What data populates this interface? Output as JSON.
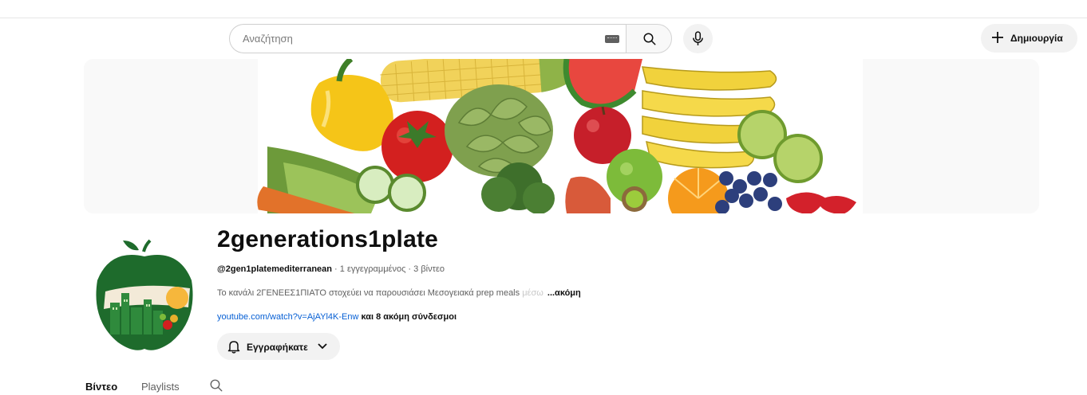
{
  "header": {
    "search": {
      "placeholder": "Αναζήτηση"
    },
    "create_label": "Δημιουργία"
  },
  "channel": {
    "name": "2generations1plate",
    "handle": "@2gen1platemediterranean",
    "meta": " · 1 εγγεγραμμένος · 3 βίντεο",
    "description": "Το κανάλι 2ΓΕΝΕΕΣ1ΠΙΑΤΟ στοχεύει να παρουσιάσει Μεσογειακά prep meals",
    "description_fade": "μέσω",
    "more_label": "...ακόμη",
    "link_url": "youtube.com/watch?v=AjAYl4K-Enw",
    "link_more": " και 8 ακόμη σύνδεσμοι",
    "subscribe_label": "Εγγραφήκατε"
  },
  "tabs": [
    "Βίντεο",
    "Playlists"
  ],
  "icons": [
    "keyboard-icon",
    "search-icon",
    "mic-icon",
    "plus-icon",
    "bell-icon",
    "chevron-down-icon",
    "tab-search-icon"
  ],
  "colors": {
    "link": "#065fd4",
    "apple_green": "#1e6b2c",
    "sun": "#f6b73c",
    "button_bg": "#f2f2f2"
  }
}
